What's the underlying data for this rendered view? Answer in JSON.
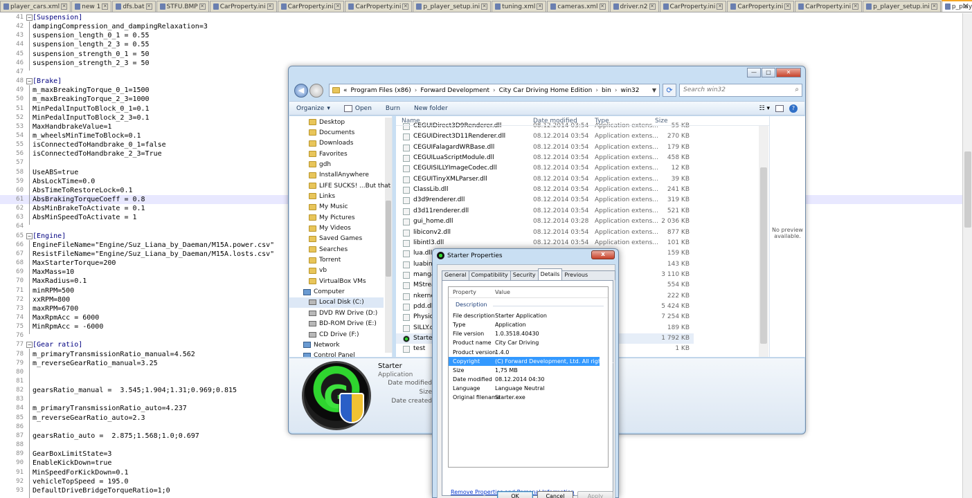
{
  "notepad": {
    "tabs": [
      {
        "label": "player_cars.xml"
      },
      {
        "label": "new  1"
      },
      {
        "label": "dfs.bat"
      },
      {
        "label": "STFU.BMP"
      },
      {
        "label": "CarProperty.ini"
      },
      {
        "label": "CarProperty.ini"
      },
      {
        "label": "CarProperty.ini"
      },
      {
        "label": "p_player_setup.ini"
      },
      {
        "label": "tuning.xml"
      },
      {
        "label": "cameras.xml"
      },
      {
        "label": "driver.n2"
      },
      {
        "label": "CarProperty.ini"
      },
      {
        "label": "CarProperty.ini"
      },
      {
        "label": "CarProperty.ini"
      },
      {
        "label": "p_player_setup.ini"
      },
      {
        "label": "p_player_setup.ini"
      }
    ],
    "active_tab": 15,
    "close_glyph": "✕",
    "lines": [
      {
        "n": "41",
        "t": "[Suspension]",
        "sec": true
      },
      {
        "n": "42",
        "t": "dampingCompression_and_dampingRelaxation=3"
      },
      {
        "n": "43",
        "t": "suspension_length_0_1 = 0.55"
      },
      {
        "n": "44",
        "t": "suspension_length_2_3 = 0.55"
      },
      {
        "n": "45",
        "t": "suspension_strength_0_1 = 50"
      },
      {
        "n": "46",
        "t": "suspension_strength_2_3 = 50"
      },
      {
        "n": "47",
        "t": ""
      },
      {
        "n": "48",
        "t": "[Brake]",
        "sec": true
      },
      {
        "n": "49",
        "t": "m_maxBreakingTorque_0_1=1500"
      },
      {
        "n": "50",
        "t": "m_maxBreakingTorque_2_3=1000"
      },
      {
        "n": "51",
        "t": "MinPedalInputToBlock_0_1=0.1"
      },
      {
        "n": "52",
        "t": "MinPedalInputToBlock_2_3=0.1"
      },
      {
        "n": "53",
        "t": "MaxHandbrakeValue=1"
      },
      {
        "n": "54",
        "t": "m_wheelsMinTimeToBlock=0.1"
      },
      {
        "n": "55",
        "t": "isConnectedToHandbrake_0_1=false"
      },
      {
        "n": "56",
        "t": "isConnectedToHandbrake_2_3=True"
      },
      {
        "n": "57",
        "t": ""
      },
      {
        "n": "58",
        "t": "UseABS=true"
      },
      {
        "n": "59",
        "t": "AbsLockTime=0.0"
      },
      {
        "n": "60",
        "t": "AbsTimeToRestoreLock=0.1"
      },
      {
        "n": "61",
        "t": "AbsBrakingTorqueCoeff = 0.8",
        "hl": true
      },
      {
        "n": "62",
        "t": "AbsMinBrakeToActivate = 0.1"
      },
      {
        "n": "63",
        "t": "AbsMinSpeedToActivate = 1"
      },
      {
        "n": "64",
        "t": ""
      },
      {
        "n": "65",
        "t": "[Engine]",
        "sec": true
      },
      {
        "n": "66",
        "t": "EngineFileName=\"Engine/Suz_Liana_by_Daeman/M15A.power.csv\""
      },
      {
        "n": "67",
        "t": "ResistFileName=\"Engine/Suz_Liana_by_Daeman/M15A.losts.csv\""
      },
      {
        "n": "68",
        "t": "MaxStarterTorque=200"
      },
      {
        "n": "69",
        "t": "MaxMass=10"
      },
      {
        "n": "70",
        "t": "MaxRadius=0.1"
      },
      {
        "n": "71",
        "t": "minRPM=500"
      },
      {
        "n": "72",
        "t": "xxRPM=800"
      },
      {
        "n": "73",
        "t": "maxRPM=6700"
      },
      {
        "n": "74",
        "t": "MaxRpmAcc = 6000"
      },
      {
        "n": "75",
        "t": "MinRpmAcc = -6000"
      },
      {
        "n": "76",
        "t": ""
      },
      {
        "n": "77",
        "t": "[Gear ratio]",
        "sec": true
      },
      {
        "n": "78",
        "t": "m_primaryTransmissionRatio_manual=4.562"
      },
      {
        "n": "79",
        "t": "m_reverseGearRatio_manual=3.25"
      },
      {
        "n": "80",
        "t": ""
      },
      {
        "n": "81",
        "t": ""
      },
      {
        "n": "82",
        "t": "gearsRatio_manual =  3.545;1.904;1.31;0.969;0.815"
      },
      {
        "n": "83",
        "t": ""
      },
      {
        "n": "84",
        "t": "m_primaryTransmissionRatio_auto=4.237"
      },
      {
        "n": "85",
        "t": "m_reverseGearRatio_auto=2.3"
      },
      {
        "n": "86",
        "t": ""
      },
      {
        "n": "87",
        "t": "gearsRatio_auto =  2.875;1.568;1.0;0.697"
      },
      {
        "n": "88",
        "t": ""
      },
      {
        "n": "89",
        "t": "GearBoxLimitState=3"
      },
      {
        "n": "90",
        "t": "EnableKickDown=true"
      },
      {
        "n": "91",
        "t": "MinSpeedForKickDown=0.1"
      },
      {
        "n": "92",
        "t": "vehicleTopSpeed = 195.0"
      },
      {
        "n": "93",
        "t": "DefaultDriveBridgeTorqueRatio=1;0"
      }
    ]
  },
  "explorer": {
    "address": [
      "«",
      "Program Files (x86)",
      "Forward Development",
      "City Car Driving Home Edition",
      "bin",
      "win32"
    ],
    "search_placeholder": "Search win32",
    "toolbar": {
      "organize": "Organize",
      "open": "Open",
      "burn": "Burn",
      "new_folder": "New folder"
    },
    "nav": [
      {
        "label": "Desktop",
        "kind": "folder"
      },
      {
        "label": "Documents",
        "kind": "folder"
      },
      {
        "label": "Downloads",
        "kind": "folder"
      },
      {
        "label": "Favorites",
        "kind": "folder"
      },
      {
        "label": "gdh",
        "kind": "folder"
      },
      {
        "label": "InstallAnywhere",
        "kind": "folder"
      },
      {
        "label": "LIFE SUCKS!  ...But that",
        "kind": "folder"
      },
      {
        "label": "Links",
        "kind": "folder"
      },
      {
        "label": "My Music",
        "kind": "folder"
      },
      {
        "label": "My Pictures",
        "kind": "folder"
      },
      {
        "label": "My Videos",
        "kind": "folder"
      },
      {
        "label": "Saved Games",
        "kind": "folder"
      },
      {
        "label": "Searches",
        "kind": "folder"
      },
      {
        "label": "Torrent",
        "kind": "folder"
      },
      {
        "label": "vb",
        "kind": "folder"
      },
      {
        "label": "VirtualBox VMs",
        "kind": "folder"
      },
      {
        "label": "Computer",
        "kind": "computer"
      },
      {
        "label": "Local Disk (C:)",
        "kind": "drive",
        "selected": true
      },
      {
        "label": "DVD RW Drive (D:)",
        "kind": "drive"
      },
      {
        "label": "BD-ROM Drive (E:)",
        "kind": "drive"
      },
      {
        "label": "CD Drive (F:)",
        "kind": "drive"
      },
      {
        "label": "Network",
        "kind": "computer"
      },
      {
        "label": "Control Panel",
        "kind": "computer"
      }
    ],
    "columns": {
      "name": "Name",
      "date": "Date modified",
      "type": "Type",
      "size": "Size"
    },
    "files": [
      {
        "name": "CEGUIDirect3D9Renderer.dll",
        "date": "08.12.2014 03:54",
        "type": "Application extens...",
        "size": "55 KB"
      },
      {
        "name": "CEGUIDirect3D11Renderer.dll",
        "date": "08.12.2014 03:54",
        "type": "Application extens...",
        "size": "270 KB"
      },
      {
        "name": "CEGUIFalagardWRBase.dll",
        "date": "08.12.2014 03:54",
        "type": "Application extens...",
        "size": "179 KB"
      },
      {
        "name": "CEGUILuaScriptModule.dll",
        "date": "08.12.2014 03:54",
        "type": "Application extens...",
        "size": "458 KB"
      },
      {
        "name": "CEGUISILLYImageCodec.dll",
        "date": "08.12.2014 03:54",
        "type": "Application extens...",
        "size": "12 KB"
      },
      {
        "name": "CEGUITinyXMLParser.dll",
        "date": "08.12.2014 03:54",
        "type": "Application extens...",
        "size": "39 KB"
      },
      {
        "name": "ClassLib.dll",
        "date": "08.12.2014 03:54",
        "type": "Application extens...",
        "size": "241 KB"
      },
      {
        "name": "d3d9renderer.dll",
        "date": "08.12.2014 03:54",
        "type": "Application extens...",
        "size": "319 KB"
      },
      {
        "name": "d3d11renderer.dll",
        "date": "08.12.2014 03:54",
        "type": "Application extens...",
        "size": "521 KB"
      },
      {
        "name": "gui_home.dll",
        "date": "08.12.2014 03:28",
        "type": "Application extens...",
        "size": "2 036 KB"
      },
      {
        "name": "libiconv2.dll",
        "date": "08.12.2014 03:54",
        "type": "Application extens...",
        "size": "877 KB"
      },
      {
        "name": "libintl3.dll",
        "date": "08.12.2014 03:54",
        "type": "Application extens...",
        "size": "101 KB"
      },
      {
        "name": "lua.dll",
        "date": "",
        "type": "",
        "size": "159 KB"
      },
      {
        "name": "luabind",
        "date": "",
        "type": "",
        "size": "143 KB"
      },
      {
        "name": "mangal",
        "date": "",
        "type": "",
        "size": "3 110 KB"
      },
      {
        "name": "MStream",
        "date": "",
        "type": "",
        "size": "554 KB"
      },
      {
        "name": "nkernel",
        "date": "",
        "type": "",
        "size": "222 KB"
      },
      {
        "name": "pdd.dll",
        "date": "",
        "type": "",
        "size": "5 424 KB"
      },
      {
        "name": "Physics",
        "date": "",
        "type": "",
        "size": "7 254 KB"
      },
      {
        "name": "SILLY.d",
        "date": "",
        "type": "",
        "size": "189 KB"
      },
      {
        "name": "Starter",
        "date": "",
        "type": "",
        "size": "1 792 KB",
        "selected": true
      },
      {
        "name": "test",
        "date": "",
        "type": "",
        "size": "1 KB"
      }
    ],
    "preview_text": "No preview available.",
    "details": {
      "name": "Starter",
      "type": "Application",
      "labels": [
        "Date modified",
        "Size",
        "Date created"
      ]
    }
  },
  "properties": {
    "title": "Starter Properties",
    "close_label": "x",
    "tabs": [
      "General",
      "Compatibility",
      "Security",
      "Details",
      "Previous Versions"
    ],
    "active_tab": 3,
    "header_property": "Property",
    "header_value": "Value",
    "group": "Description",
    "rows": [
      {
        "k": "File description",
        "v": "Starter Application"
      },
      {
        "k": "Type",
        "v": "Application"
      },
      {
        "k": "File version",
        "v": "1.0.3518.40430"
      },
      {
        "k": "Product name",
        "v": "City Car Driving"
      },
      {
        "k": "Product version",
        "v": "1.4.0"
      },
      {
        "k": "Copyright",
        "v": "(C) Forward Development, Ltd. All rights ...",
        "selected": true
      },
      {
        "k": "Size",
        "v": "1,75 MB"
      },
      {
        "k": "Date modified",
        "v": "08.12.2014 04:30"
      },
      {
        "k": "Language",
        "v": "Language Neutral"
      },
      {
        "k": "Original filename",
        "v": "Starter.exe"
      }
    ],
    "remove_link": "Remove Properties and Personal Information",
    "buttons": {
      "ok": "OK",
      "cancel": "Cancel",
      "apply": "Apply"
    }
  }
}
